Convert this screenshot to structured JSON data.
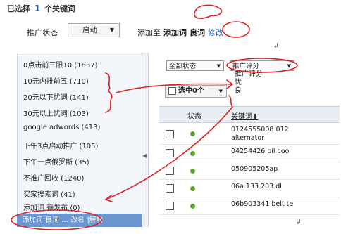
{
  "header": {
    "selected_prefix": "已选择",
    "selected_count": "1",
    "selected_suffix": "个关键词",
    "status_label": "推广状态",
    "status_value": "启动",
    "add_to_label": "添加至",
    "add_keyword": "添加词",
    "good_word": "良词",
    "modify_link": "修改"
  },
  "left_list": {
    "items": [
      "0点击前三限10 (1837)",
      "10元内排前五 (710)",
      "20元以下忧词 (141)",
      "30元以上忧词 (103)",
      "google adwords (413)",
      "下午3点启动推广 (105)",
      "下午一点俄罗斯 (35)",
      "不推广回收 (1240)",
      "买家搜索词 (41)",
      "添加词  待发布 (0)"
    ],
    "footer": [
      "添加词",
      "良词",
      "...",
      "改名",
      "|解散"
    ]
  },
  "filters": {
    "all_status": "全部状态",
    "rating": "推广评分",
    "rating_options": [
      "推广评分",
      "忧",
      "良"
    ]
  },
  "selected_btn": "选中0个",
  "table": {
    "col_status": "状态",
    "col_keyword": "关键词",
    "rows": [
      {
        "kw": "0124555008 012",
        "kw2": "alternator"
      },
      {
        "kw": "04254426 oil coo",
        "kw2": ""
      },
      {
        "kw": "050905205ap",
        "kw2": ""
      },
      {
        "kw": "06a 133 203 dl",
        "kw2": ""
      },
      {
        "kw": "06b903341 belt te",
        "kw2": ""
      }
    ]
  },
  "colors": {
    "accent": "#1a58b5",
    "footer_bg": "#6a97cf",
    "annotation": "#e02020",
    "status_green": "#5aa32a"
  }
}
